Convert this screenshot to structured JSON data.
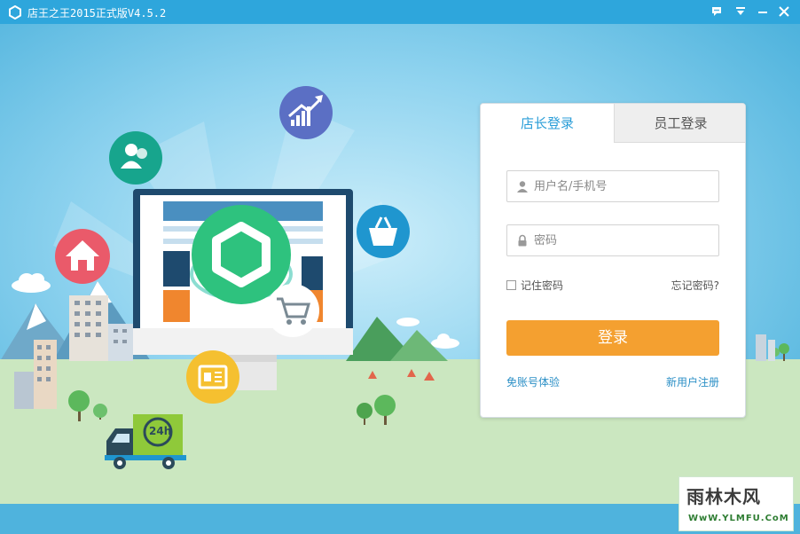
{
  "window": {
    "title": "店王之王2015正式版V4.5.2",
    "controls": [
      "chat-icon",
      "dropdown-icon",
      "minimize-icon",
      "close-icon"
    ]
  },
  "login": {
    "tabs": [
      {
        "label": "店长登录",
        "active": true
      },
      {
        "label": "员工登录",
        "active": false
      }
    ],
    "username_placeholder": "用户名/手机号",
    "password_placeholder": "密码",
    "remember_label": "记住密码",
    "forgot_label": "忘记密码?",
    "login_button": "登录",
    "trial_link": "免账号体验",
    "register_link": "新用户注册"
  },
  "illustration": {
    "badge_24h": "24h"
  },
  "watermark": {
    "main": "雨林木风",
    "sub": "WwW.YLMFU.CoM"
  },
  "colors": {
    "titlebar": "#2ea6dc",
    "sky": "#4fb3dd",
    "grass": "#cbe7c0",
    "accent_blue": "#2b9ed8",
    "login_orange": "#f4a030",
    "logo_green": "#2ec27e"
  }
}
